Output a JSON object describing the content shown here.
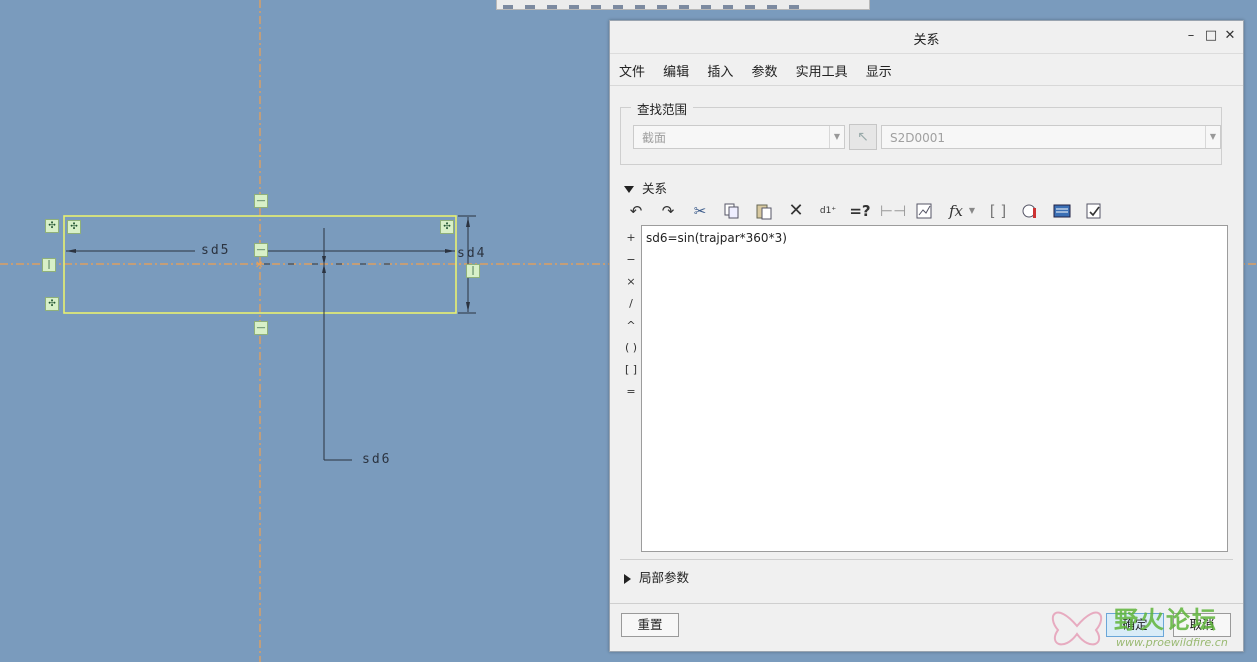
{
  "sketch": {
    "dim_sd5": "sd5",
    "dim_sd4": "sd4",
    "dim_sd6": "sd6"
  },
  "dialog": {
    "title": "关系",
    "window_controls": {
      "minimize": "–",
      "maximize": "□",
      "close": "✕"
    },
    "menu": [
      "文件",
      "编辑",
      "插入",
      "参数",
      "实用工具",
      "显示"
    ],
    "scope": {
      "legend": "查找范围",
      "type_value": "截面",
      "name_value": "S2D0001"
    },
    "relations": {
      "header": "关系",
      "operators": [
        "+",
        "−",
        "×",
        "/",
        "^",
        "( )",
        "[ ]",
        "="
      ],
      "text": "sd6=sin(trajpar*360*3)"
    },
    "local_params": {
      "header": "局部参数"
    },
    "buttons": {
      "reset": "重置",
      "ok": "确定",
      "cancel": "取消"
    }
  },
  "watermark": {
    "text": "野火论坛",
    "sub": "www.proewildfire.cn"
  },
  "colors": {
    "canvas_bg": "#7a9bbd",
    "centerline": "#f0a050",
    "sketch_rect": "#e8f070",
    "dim_line": "#2b3340"
  }
}
